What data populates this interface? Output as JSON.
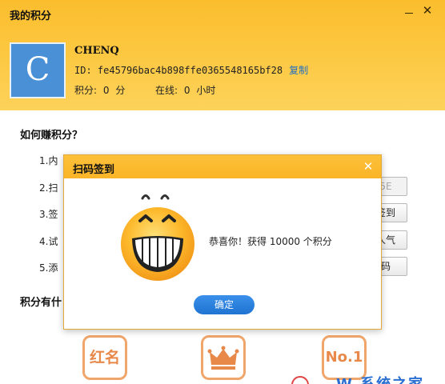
{
  "window": {
    "title": "我的积分"
  },
  "profile": {
    "avatar_letter": "C",
    "username": "CHENQ",
    "id_label": "ID:",
    "id_value": "fe45796bac4b898ffe0365548165bf28",
    "copy_label": "复制",
    "points_label": "积分:",
    "points_value": "0",
    "points_unit": "分",
    "online_label": "在线:",
    "online_value": "0",
    "online_unit": "小时"
  },
  "earn": {
    "title": "如何赚积分？",
    "tasks": [
      {
        "label": "1.内",
        "button": ""
      },
      {
        "label": "2.扫",
        "button": "5E"
      },
      {
        "label": "3.签",
        "button": "签到"
      },
      {
        "label": "4.试",
        "button": "人气"
      },
      {
        "label": "5.添",
        "button": "码"
      }
    ]
  },
  "uses": {
    "title": "积分有什",
    "perks": [
      {
        "label": "红名",
        "icon": "crown-icon"
      },
      {
        "label": "",
        "icon": "crown-icon"
      },
      {
        "label": "No.1",
        "icon": "no1-icon"
      }
    ]
  },
  "dialog": {
    "title": "扫码签到",
    "message": "恭喜你！获得 10000 个积分",
    "ok_label": "确定"
  },
  "colors": {
    "header": "#fcc73f",
    "accent_blue": "#1f73d2",
    "link": "#1f6fc4",
    "perk_orange": "#e8894a"
  }
}
